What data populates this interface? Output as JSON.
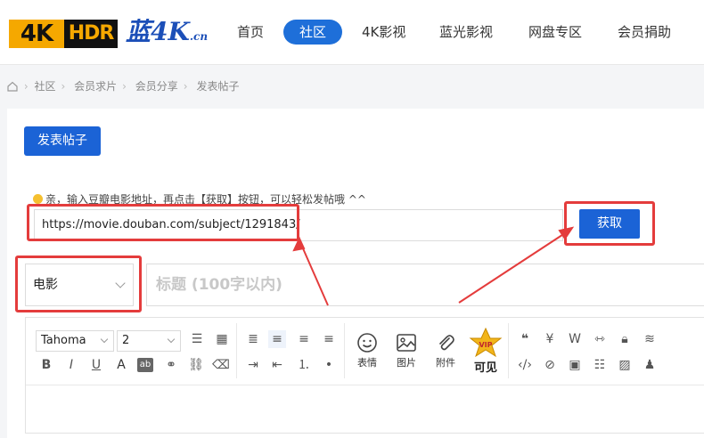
{
  "header": {
    "logo_4k": "4K",
    "logo_hdr": "HDR",
    "logo_cn": "蓝4K",
    "logo_cn_suffix": ".cn",
    "nav": [
      "首页",
      "社区",
      "4K影视",
      "蓝光影视",
      "网盘专区",
      "会员捐助"
    ],
    "active_nav": "社区"
  },
  "breadcrumb": [
    "社区",
    "会员求片",
    "会员分享",
    "发表帖子"
  ],
  "post_button": "发表帖子",
  "tip": "亲，输入豆瓣电影地址，再点击【获取】按钮，可以轻松发帖哦 ^^",
  "url_input": {
    "value": "https://movie.douban.com/subject/1291843/"
  },
  "fetch_button": "获取",
  "category_select": {
    "value": "电影"
  },
  "title_input": {
    "placeholder": "标题 (100字以内)"
  },
  "toolbar": {
    "font": "Tahoma",
    "size": "2",
    "emoji_label": "表情",
    "image_label": "图片",
    "attach_label": "附件",
    "vip_label": "可见",
    "vip_badge": "VIP"
  },
  "colors": {
    "accent": "#1b63d6",
    "highlight": "#e43c3c",
    "logo_orange": "#f5a800"
  }
}
